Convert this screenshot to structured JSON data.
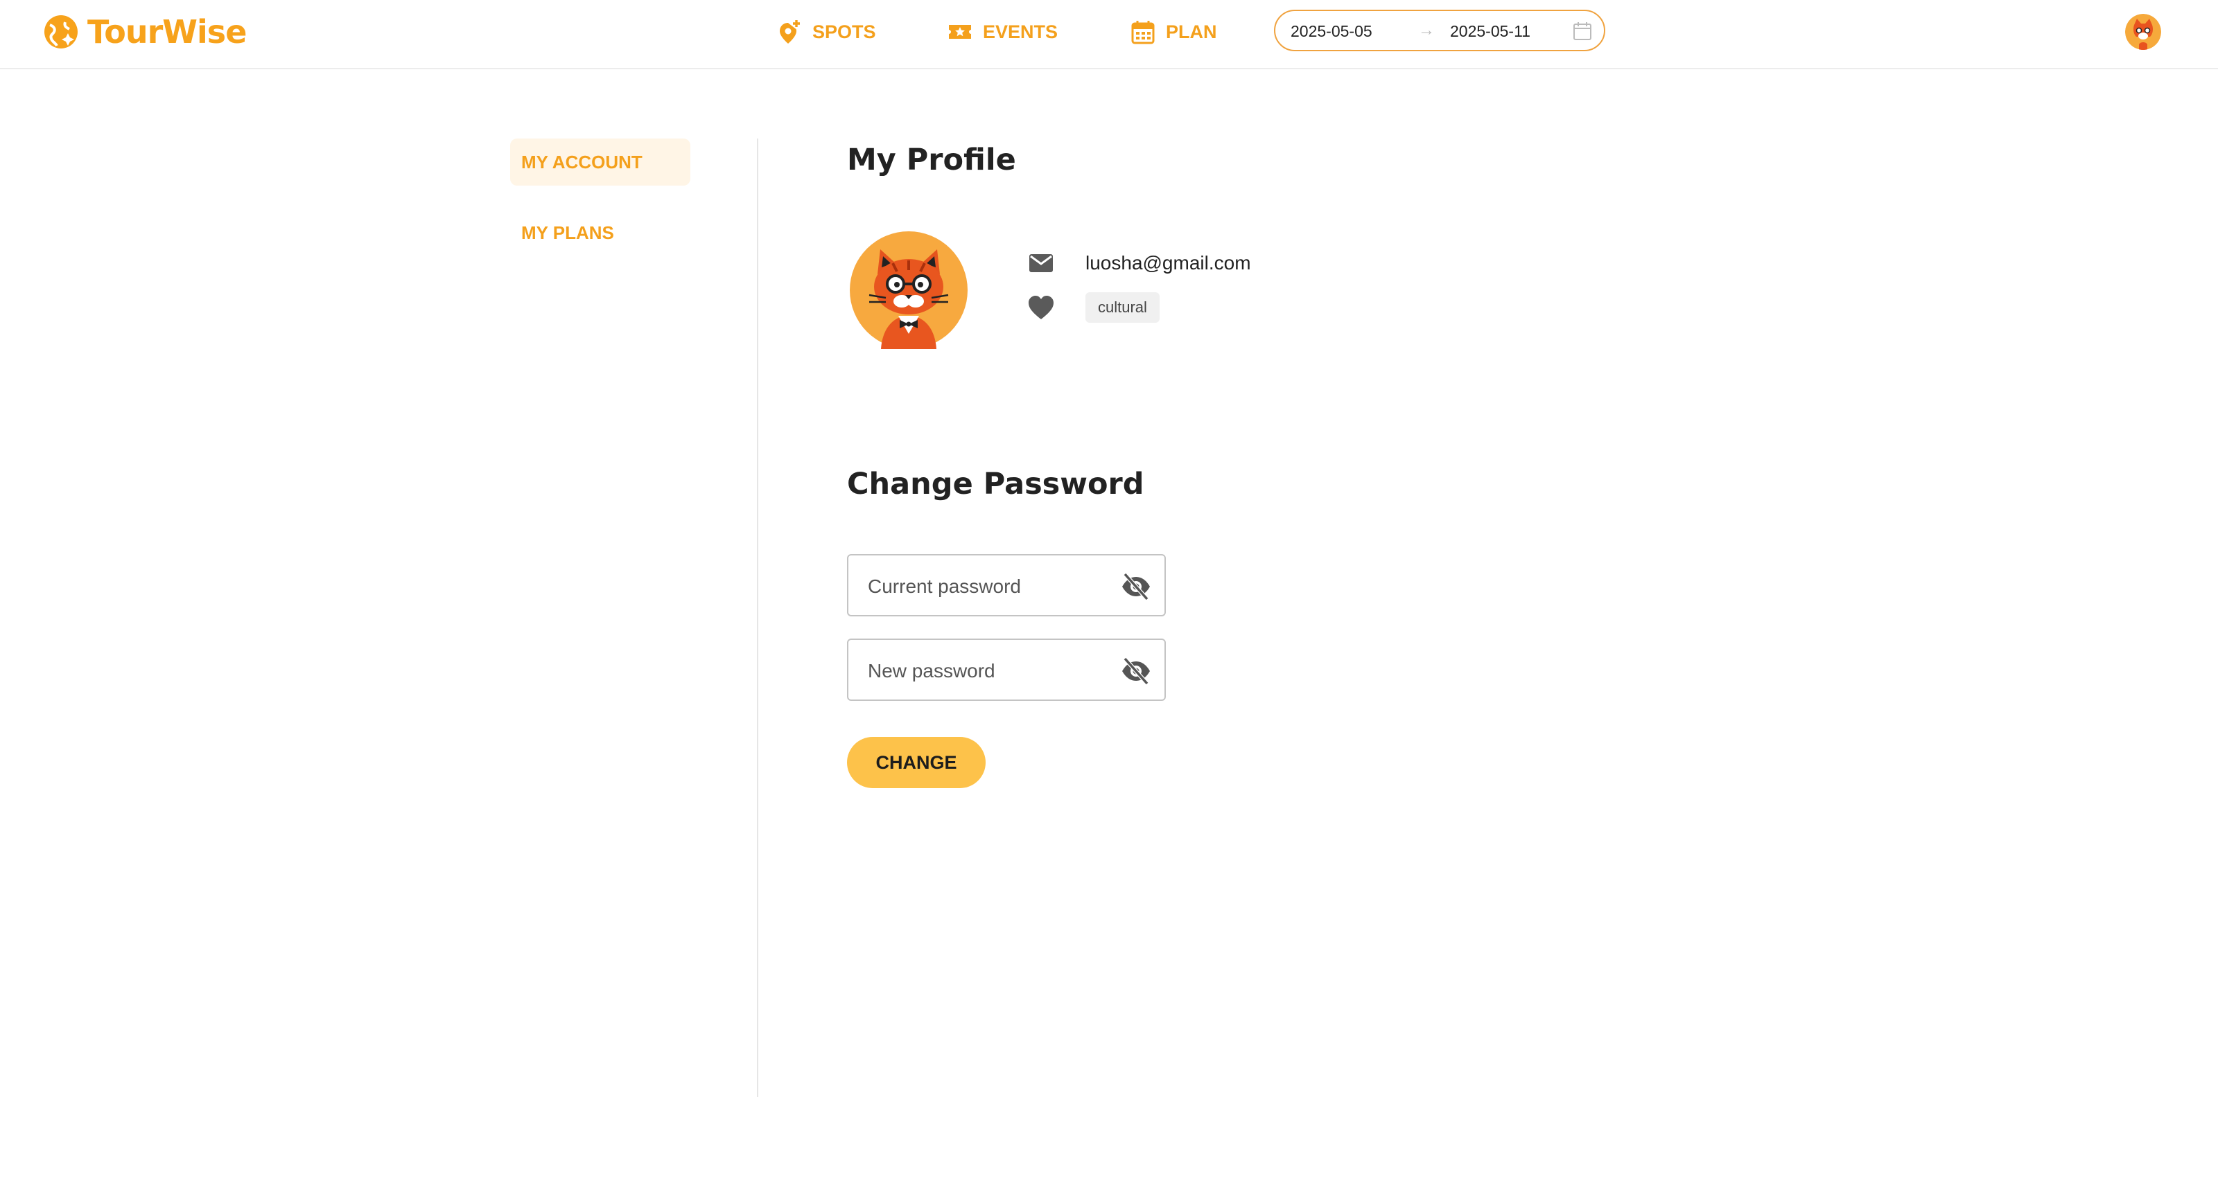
{
  "brand": {
    "name": "TourWise",
    "accent": "#f4a01c",
    "button_color": "#fdc24a"
  },
  "nav": {
    "items": [
      {
        "label": "SPOTS",
        "icon": "map-pin-plus-icon"
      },
      {
        "label": "EVENTS",
        "icon": "ticket-star-icon"
      },
      {
        "label": "PLAN",
        "icon": "calendar-icon"
      }
    ],
    "date_range": {
      "start": "2025-05-05",
      "end": "2025-05-11",
      "separator": "→"
    }
  },
  "sidebar": {
    "items": [
      {
        "label": "MY ACCOUNT",
        "active": true
      },
      {
        "label": "MY PLANS",
        "active": false
      }
    ]
  },
  "profile": {
    "title": "My Profile",
    "email": "luosha@gmail.com",
    "interests": [
      "cultural"
    ]
  },
  "password": {
    "title": "Change Password",
    "current_placeholder": "Current password",
    "new_placeholder": "New password",
    "submit_label": "CHANGE"
  }
}
